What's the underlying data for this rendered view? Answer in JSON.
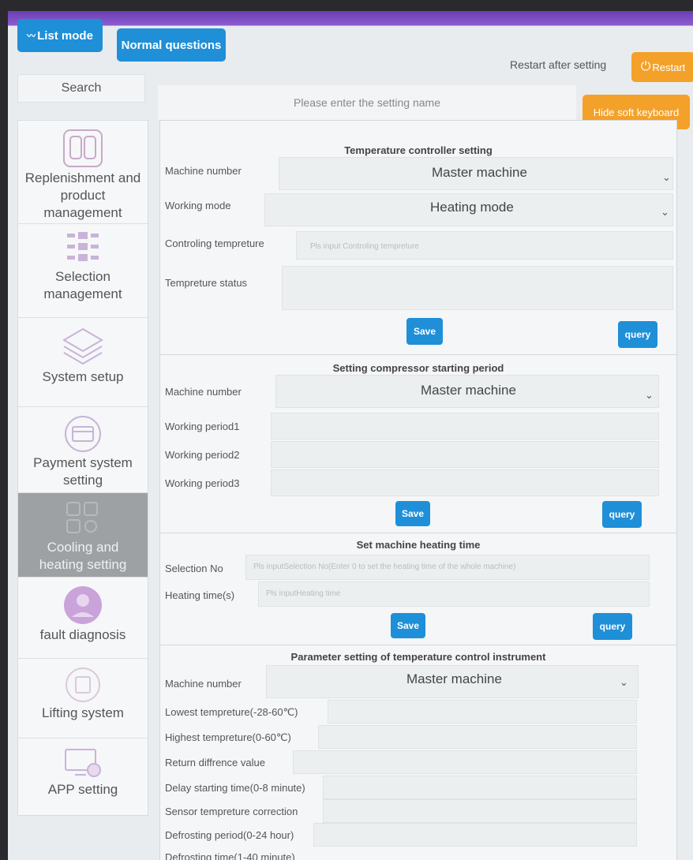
{
  "header": {
    "list_mode_label": "List mode",
    "normal_questions_label": "Normal questions",
    "restart_note": "Restart after setting",
    "restart_label": "Restart"
  },
  "search": {
    "tab_label": "Search",
    "placeholder": "Please enter the setting name",
    "hide_keyboard_label": "Hide soft keyboard"
  },
  "sidebar": {
    "items": [
      {
        "label": "Replenishment and product management",
        "icon": "phone-icon"
      },
      {
        "label": "Selection management",
        "icon": "grid-icon"
      },
      {
        "label": "System setup",
        "icon": "layers-icon"
      },
      {
        "label": "Payment system setting",
        "icon": "card-icon"
      },
      {
        "label": "Cooling and heating setting",
        "icon": "gear-grid-icon",
        "active": true
      },
      {
        "label": "fault diagnosis",
        "icon": "person-icon"
      },
      {
        "label": "Lifting system",
        "icon": "lift-icon"
      },
      {
        "label": "APP setting",
        "icon": "monitor-gear-icon"
      }
    ]
  },
  "temp_controller": {
    "title": "Temperature controller setting",
    "machine_number_label": "Machine number",
    "machine_number_value": "Master machine",
    "working_mode_label": "Working mode",
    "working_mode_value": "Heating mode",
    "controlling_label": "Controling tempreture",
    "controlling_placeholder": "Pls input Controling tempreture",
    "status_label": "Tempreture status",
    "save_label": "Save",
    "query_label": "query"
  },
  "compressor": {
    "title": "Setting compressor starting period",
    "machine_number_label": "Machine number",
    "machine_number_value": "Master machine",
    "period1_label": "Working period1",
    "period2_label": "Working period2",
    "period3_label": "Working period3",
    "save_label": "Save",
    "query_label": "query"
  },
  "heating_time": {
    "title": "Set machine heating time",
    "selection_label": "Selection No",
    "selection_placeholder": "Pls inputSelection No(Enter 0 to set the heating time of the whole machine)",
    "heating_label": "Heating time(s)",
    "heating_placeholder": "Pls inputHeating time",
    "save_label": "Save",
    "query_label": "query"
  },
  "instrument": {
    "title": "Parameter setting of temperature control instrument",
    "machine_number_label": "Machine number",
    "machine_number_value": "Master machine",
    "lowest_label": "Lowest tempreture(-28-60℃)",
    "highest_label": "Highest tempreture(0-60℃)",
    "return_label": "Return diffrence value",
    "delay_label": "Delay starting time(0-8 minute)",
    "sensor_label": "Sensor tempreture correction",
    "defrost_period_label": "Defrosting period(0-24 hour)",
    "defrost_time_label": "Defrosting time(1-40 minute)"
  },
  "colors": {
    "accent_blue": "#1f8fd8",
    "accent_orange": "#f4a12a",
    "header_purple": "#6a3fb3"
  }
}
